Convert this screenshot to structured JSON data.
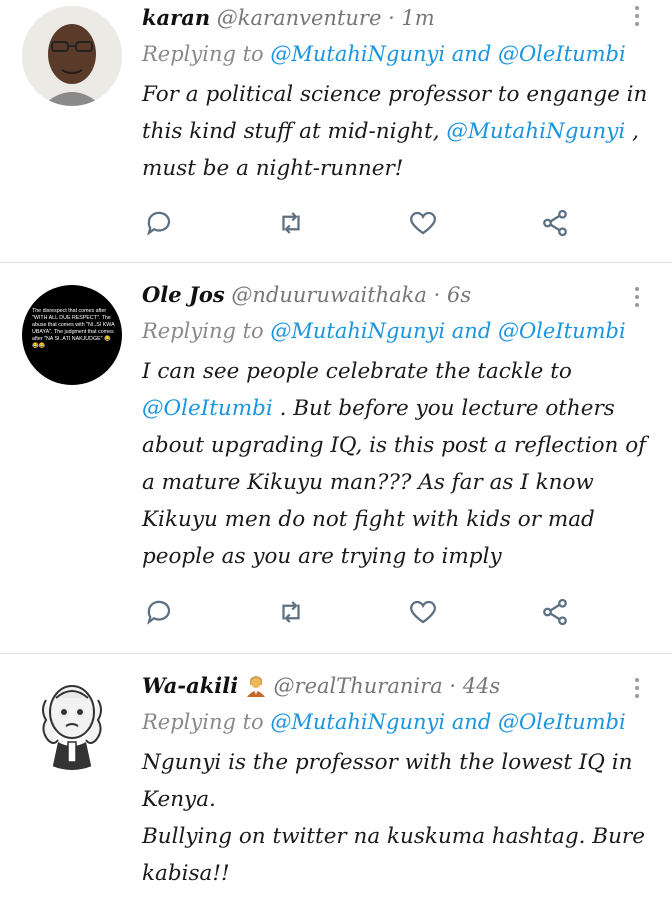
{
  "tweets": [
    {
      "display_name": "karan",
      "handle": "@karanventure",
      "time": "· 1m",
      "replying_to": {
        "prefix": "Replying to",
        "user1": "@MutahiNgunyi",
        "joiner": "and",
        "user2": "@OleItumbi"
      },
      "body": {
        "part1": "For a political science professor to engange in this kind stuff at mid-night, ",
        "mention": "@MutahiNgunyi",
        "part2": " , must be a night-runner!"
      }
    },
    {
      "display_name": "Ole Jos",
      "handle": "@nduuruwaithaka",
      "time": "· 6s",
      "avatar_text": "The disrespect that comes after \"WITH ALL DUE RESPECT\". The abuse that comes with \"NI..SI KWA UBAYA\". The judgment that comes after \"NA SI..ATI NAKJUDGE\" 😂😂😂",
      "replying_to": {
        "prefix": "Replying to",
        "user1": "@MutahiNgunyi",
        "joiner": "and",
        "user2": "@OleItumbi"
      },
      "body": {
        "part1": "I can see people celebrate the tackle to ",
        "mention": "@OleItumbi",
        "part2": " . But before you lecture others about upgrading IQ, is this post a reflection of a mature Kikuyu man??? As far as I know Kikuyu men do not fight with kids or mad people as you are trying to imply"
      }
    },
    {
      "display_name": "Wa-akili",
      "handle": "@realThuranira",
      "time": "· 44s",
      "replying_to": {
        "prefix": "Replying to",
        "user1": "@MutahiNgunyi",
        "joiner": "and",
        "user2": "@OleItumbi"
      },
      "body": {
        "line1": "Ngunyi is the professor with the lowest IQ in Kenya.",
        "line2": "Bullying on twitter na kuskuma hashtag. Bure kabisa!!"
      }
    }
  ],
  "colors": {
    "link": "#1b95e0",
    "meta": "#777777",
    "icon": "#5b7083",
    "divider": "#e2e2e2"
  }
}
